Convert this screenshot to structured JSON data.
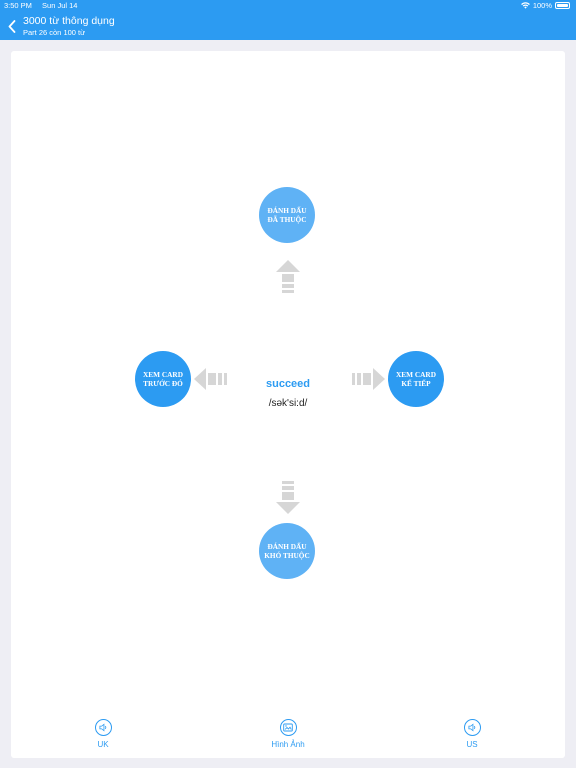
{
  "status_bar": {
    "time": "3:50 PM",
    "date": "Sun Jul 14",
    "battery": "100%"
  },
  "header": {
    "title": "3000 từ thông dụng",
    "subtitle": "Part 26 còn 100 từ"
  },
  "card": {
    "word": "succeed",
    "ipa": "/sək'si:d/",
    "up_action": [
      "ĐÁNH DẤU",
      "ĐÃ THUỘC"
    ],
    "left_action": [
      "XEM CARD",
      "TRƯỚC ĐÓ"
    ],
    "right_action": [
      "XEM CARD",
      "KẾ TIẾP"
    ],
    "down_action": [
      "ĐÁNH DẤU",
      "KHÓ THUỘC"
    ]
  },
  "bottom": {
    "uk_label": "UK",
    "image_label": "Hình Ảnh",
    "us_label": "US"
  },
  "colors": {
    "primary": "#2c9bf2",
    "primary_light": "#5fb2f5",
    "arrow_gray": "#d6d6d6"
  }
}
